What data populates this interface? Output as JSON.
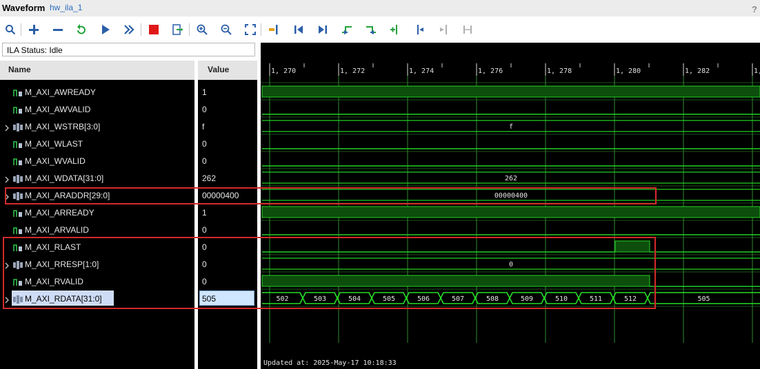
{
  "window": {
    "title": "Waveform",
    "subtitle": "hw_ila_1",
    "help": "?"
  },
  "toolbar": {
    "buttons": [
      "search",
      "add",
      "remove",
      "refresh",
      "run-trigger",
      "run-immediate",
      "stop",
      "export",
      "zoom-in",
      "zoom-out",
      "zoom-fit",
      "go-to-cursor",
      "go-to-start",
      "go-to-end",
      "previous-transition",
      "next-transition",
      "add-marker",
      "previous-marker",
      "next-marker",
      "swap-cursors"
    ]
  },
  "ila_status": "ILA Status:  Idle",
  "columns": {
    "name": "Name",
    "value": "Value"
  },
  "signals": [
    {
      "name": "M_AXI_AWREADY",
      "value": "1",
      "bus": false
    },
    {
      "name": "M_AXI_AWVALID",
      "value": "0",
      "bus": false
    },
    {
      "name": "M_AXI_WSTRB[3:0]",
      "value": "f",
      "bus": true
    },
    {
      "name": "M_AXI_WLAST",
      "value": "0",
      "bus": false
    },
    {
      "name": "M_AXI_WVALID",
      "value": "0",
      "bus": false
    },
    {
      "name": "M_AXI_WDATA[31:0]",
      "value": "262",
      "bus": true
    },
    {
      "name": "M_AXI_ARADDR[29:0]",
      "value": "00000400",
      "bus": true
    },
    {
      "name": "M_AXI_ARREADY",
      "value": "1",
      "bus": false
    },
    {
      "name": "M_AXI_ARVALID",
      "value": "0",
      "bus": false
    },
    {
      "name": "M_AXI_RLAST",
      "value": "0",
      "bus": false
    },
    {
      "name": "M_AXI_RRESP[1:0]",
      "value": "0",
      "bus": true
    },
    {
      "name": "M_AXI_RVALID",
      "value": "0",
      "bus": false
    },
    {
      "name": "M_AXI_RDATA[31:0]",
      "value": "505",
      "bus": true,
      "selected": true
    }
  ],
  "timeline": {
    "ticks": [
      "1, 270",
      "1, 272",
      "1, 274",
      "1, 276",
      "1, 278",
      "1, 280",
      "1, 282",
      "1,"
    ],
    "bus_labels": {
      "wstrb": "f",
      "wdata": "262",
      "araddr": "00000400",
      "rresp": "0"
    },
    "rdata_values": [
      "502",
      "503",
      "504",
      "505",
      "506",
      "507",
      "508",
      "509",
      "510",
      "511",
      "512",
      "505"
    ]
  },
  "updated": "Updated at: 2025-May-17 10:18:33",
  "colors": {
    "wave_green": "#22d022",
    "wave_fill": "#0d4e0d",
    "grid": "#2e8b2e",
    "red_box": "#d42a2a",
    "selection": "#cfdcf5"
  }
}
